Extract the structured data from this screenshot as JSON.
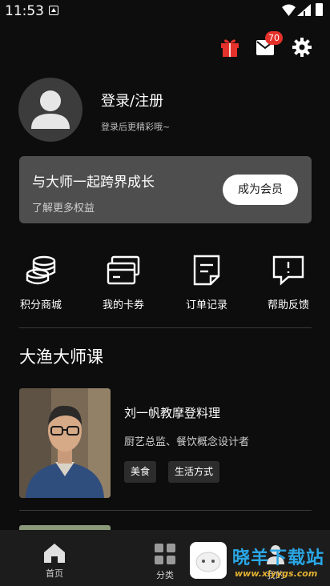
{
  "status_bar": {
    "time": "11:53"
  },
  "header": {
    "mail_badge": "70"
  },
  "profile": {
    "login_title": "登录/注册",
    "login_subtitle": "登录后更精彩哦~"
  },
  "member_card": {
    "title": "与大师一起跨界成长",
    "subtitle": "了解更多权益",
    "button_label": "成为会员"
  },
  "quick_links": [
    {
      "label": "积分商城",
      "icon": "coins-icon"
    },
    {
      "label": "我的卡券",
      "icon": "card-icon"
    },
    {
      "label": "订单记录",
      "icon": "order-record-icon"
    },
    {
      "label": "帮助反馈",
      "icon": "feedback-icon"
    }
  ],
  "section": {
    "title": "大渔大师课"
  },
  "course": {
    "title": "刘一帆教摩登料理",
    "description": "厨艺总监、餐饮概念设计者",
    "tags": [
      "美食",
      "生活方式"
    ]
  },
  "bottom_nav": [
    {
      "label": "首页",
      "icon": "home-icon"
    },
    {
      "label": "分类",
      "icon": "category-icon"
    },
    {
      "label": "我的",
      "icon": "profile-icon"
    }
  ],
  "watermark": {
    "text": "晓羊下载站",
    "url": "www.xiyygs.com"
  },
  "colors": {
    "background": "#0d0d0d",
    "card": "#4e4e4e",
    "badge": "#e4312b",
    "gift": "#e4312b"
  }
}
